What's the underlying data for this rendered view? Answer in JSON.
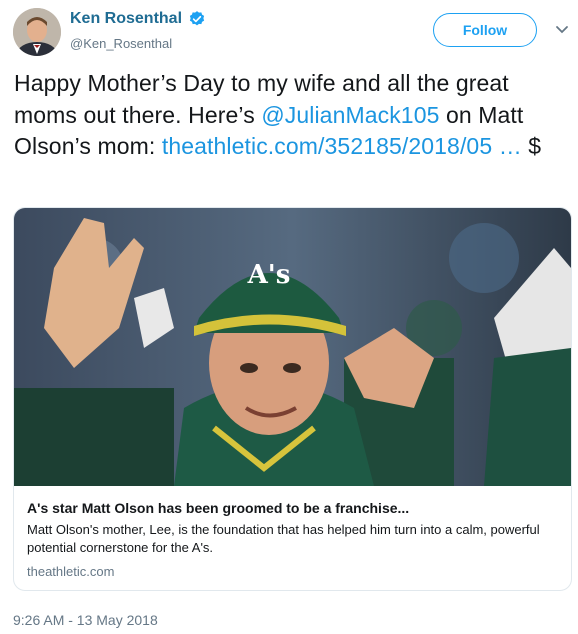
{
  "author": {
    "name": "Ken Rosenthal",
    "handle": "@Ken_Rosenthal",
    "verified": true,
    "avatar_icon": "avatar-photo-icon"
  },
  "actions": {
    "follow_label": "Follow",
    "more_icon": "chevron-down-icon"
  },
  "tweet": {
    "text_part1": "Happy Mother’s Day to my wife and all the great moms out there. Here’s ",
    "mention": "@JulianMack105",
    "text_part2": " on Matt Olson’s mom: ",
    "link": "theathletic.com/352185/2018/05  …",
    "text_part3": " $"
  },
  "card": {
    "image_icon": "baseball-player-photo",
    "title": "A's star Matt Olson has been groomed to be a franchise...",
    "description": "Matt Olson's mother, Lee, is the foundation that has helped him turn into a calm, powerful potential cornerstone for the A's.",
    "domain": "theathletic.com"
  },
  "timestamp": "9:26 AM - 13 May 2018",
  "colors": {
    "accent": "#1da1f2",
    "link": "#1b95e0",
    "name": "#1f6c93",
    "muted": "#657786"
  }
}
